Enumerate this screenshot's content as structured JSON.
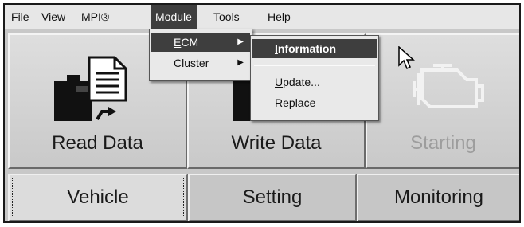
{
  "menubar": {
    "items": [
      {
        "mnemonic": "F",
        "rest": "ile"
      },
      {
        "mnemonic": "V",
        "rest": "iew"
      },
      {
        "label": "MPI®"
      },
      {
        "mnemonic": "M",
        "rest": "odule"
      },
      {
        "mnemonic": "T",
        "rest": "ools"
      },
      {
        "mnemonic": "H",
        "rest": "elp"
      }
    ]
  },
  "module_menu": {
    "items": [
      {
        "mnemonic": "E",
        "rest": "CM",
        "has_submenu": true
      },
      {
        "mnemonic": "C",
        "rest": "luster",
        "has_submenu": true
      }
    ]
  },
  "ecm_submenu": {
    "items": [
      {
        "mnemonic": "I",
        "rest": "nformation"
      },
      {
        "mnemonic": "U",
        "rest": "pdate..."
      },
      {
        "mnemonic": "R",
        "rest": "eplace"
      }
    ]
  },
  "toolbar": {
    "read_label": "Read Data",
    "write_label": "Write Data",
    "starting_label": "Starting"
  },
  "tabs": {
    "vehicle": "Vehicle",
    "setting": "Setting",
    "monitoring": "Monitoring"
  },
  "icons": {
    "read": "ecu-with-document-arrow-icon",
    "write": "ecu-with-document-arrow-icon",
    "starting": "engine-icon"
  },
  "colors": {
    "highlight": "#3e3e3e",
    "background": "#c8c8c8"
  }
}
